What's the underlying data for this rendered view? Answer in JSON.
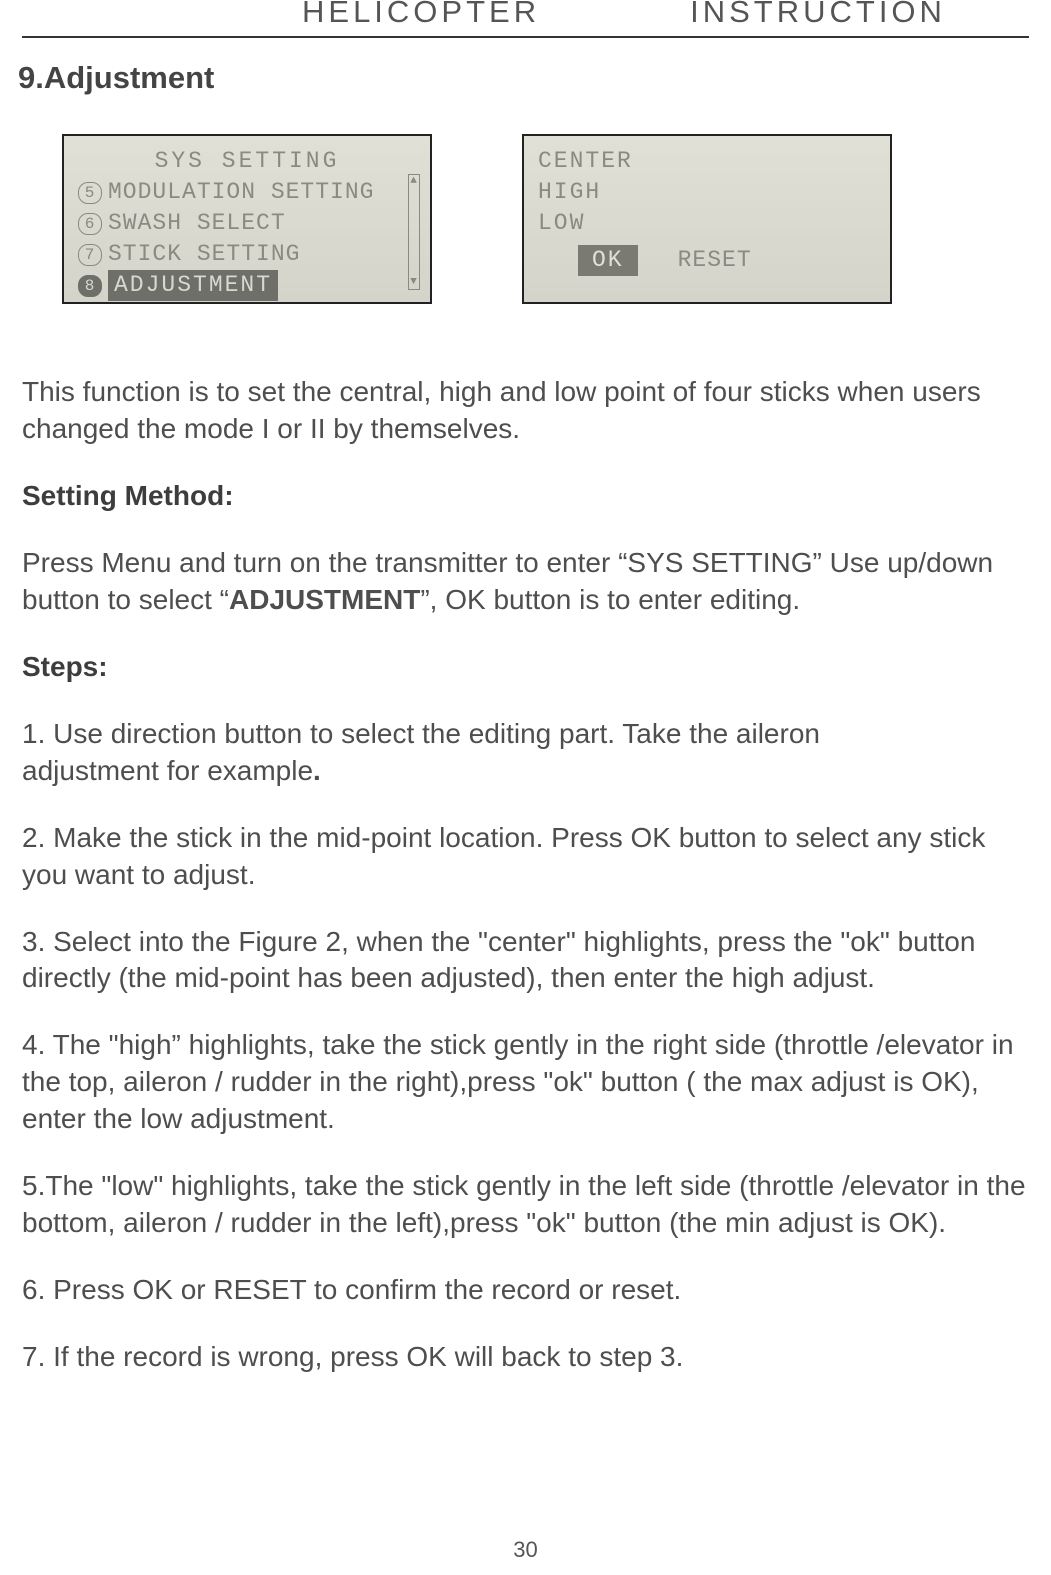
{
  "header": {
    "left": "HELICOPTER",
    "right": "INSTRUCTION"
  },
  "section_title": "9.Adjustment",
  "lcd1": {
    "title": "SYS SETTING",
    "items": [
      {
        "num": "5",
        "label": "MODULATION SETTING",
        "selected": false
      },
      {
        "num": "6",
        "label": "SWASH SELECT",
        "selected": false
      },
      {
        "num": "7",
        "label": "STICK SETTING",
        "selected": false
      },
      {
        "num": "8",
        "label": "ADJUSTMENT",
        "selected": true
      }
    ]
  },
  "lcd2": {
    "options": [
      "CENTER",
      "HIGH",
      "LOW"
    ],
    "ok": "OK",
    "reset": "RESET"
  },
  "intro": "This function is to set the central, high and low point of four sticks when users changed the mode I or II by themselves.",
  "setting_method_label": "Setting Method:",
  "setting_method_body_pre": "Press Menu and turn on the transmitter to enter “SYS SETTING” Use up/down button to select “",
  "setting_method_bold": "ADJUSTMENT",
  "setting_method_body_post": "”, OK button is to enter editing.",
  "steps_label": "Steps:",
  "step1a": "1. Use direction button to select the editing  part.  Take  the  aileron",
  "step1b": "adjustment  for  example",
  "step1dot": ".",
  "step2": "2. Make the  stick in the mid-point location.   Press OK button to select any stick you  want to adjust.",
  "step3": "3. Select into the Figure 2, when the \"center\" highlights, press the \"ok\" button directly (the mid-point has been  adjusted), then enter the high adjust.",
  "step4": "4. The \"high” highlights,  take  the  stick  gently  in the right side  (throttle /elevator in the top, aileron / rudder in the right),press \"ok\"  button  ( the max  adjust is OK), enter the  low  adjustment.",
  "step5": "5.The \"low\" highlights,  take the  stick  gently  in the left side (throttle  /elevator in the bottom, aileron / rudder in the left),press \"ok\" button (the min  adjust is OK).",
  "step6": "6. Press OK or RESET to confirm the record or reset.",
  "step7": "7. If the record is wrong, press OK will back to step 3.",
  "page_number": "30"
}
